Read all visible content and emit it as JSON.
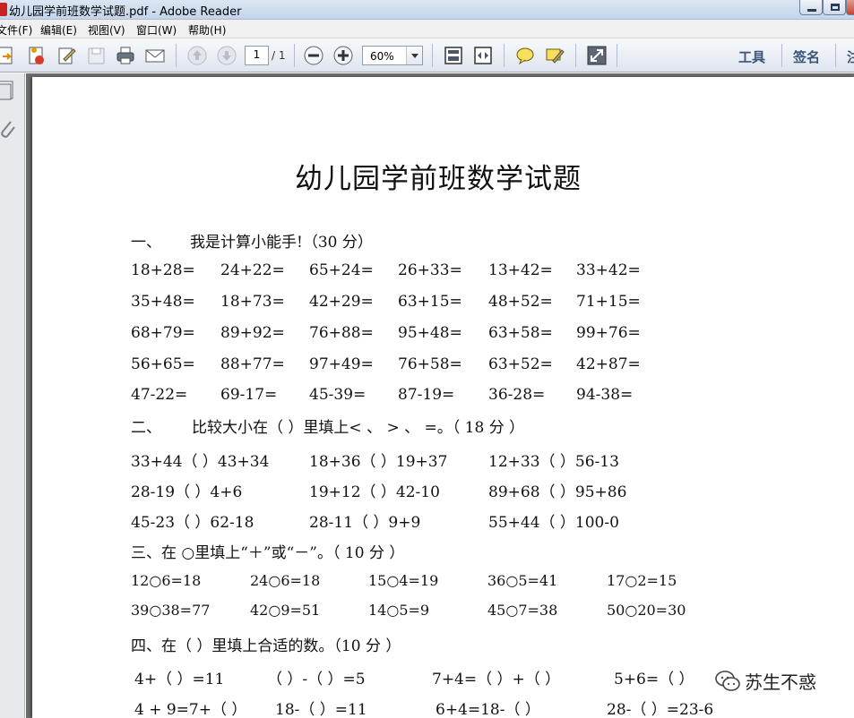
{
  "window": {
    "title": "幼儿园学前班数学试题.pdf - Adobe Reader"
  },
  "menu": {
    "items": [
      "文件(F)",
      "编辑(E)",
      "视图(V)",
      "窗口(W)",
      "帮助(H)"
    ]
  },
  "toolbar": {
    "page_current": "1",
    "page_total": "/ 1",
    "zoom": "60%",
    "tools_label": "工具",
    "sign_label": "签名",
    "comment_label": "注"
  },
  "document": {
    "title": "幼儿园学前班数学试题",
    "section1": {
      "num": "一、",
      "heading": "我是计算小能手!（30 分）",
      "rows": [
        [
          "18+28=",
          "24+22=",
          "65+24=",
          "26+33=",
          "13+42=",
          "33+42="
        ],
        [
          "35+48=",
          "18+73=",
          "42+29=",
          "63+15=",
          "48+52=",
          "71+15="
        ],
        [
          "68+79=",
          "89+92=",
          "76+88=",
          "95+48=",
          "63+58=",
          "99+76="
        ],
        [
          "56+65=",
          "88+77=",
          "97+49=",
          "76+58=",
          "63+52=",
          "42+87="
        ],
        [
          "47-22=",
          "69-17=",
          "45-39=",
          "87-19=",
          "36-28=",
          "94-38="
        ]
      ]
    },
    "section2": {
      "num": "二、",
      "heading": "比较大小在（ ）里填上<  、  >  、  =。（ 18 分 ）",
      "rows": [
        [
          "33+44（    ）43+34",
          "18+36（    ）19+37",
          "12+33（    ）56-13"
        ],
        [
          "28-19（    ）4+6",
          "19+12（    ）42-10",
          "89+68（    ）95+86"
        ],
        [
          "45-23（    ）62-18",
          "28-11（    ）9+9",
          "55+44（    ）100-0"
        ]
      ]
    },
    "section3": {
      "heading": "三、在 ○里填上“＋”或“－”。（ 10 分 ）",
      "rows": [
        [
          "12○6=18",
          "24○6=18",
          "15○4=19",
          "36○5=41",
          "17○2=15"
        ],
        [
          "39○38=77",
          "42○9=51",
          "14○5=9",
          "45○7=38",
          "50○20=30"
        ]
      ]
    },
    "section4": {
      "heading": "四、在（ ）里填上合适的数。（10 分  ）",
      "rows": [
        [
          "4+（  ）=11",
          "（  ）-（    ）=5",
          "7+4=（    ）+（    ）",
          "5+6=（    ）"
        ],
        [
          "4 + 9=7+（    ）",
          "18-（    ）=11",
          "6+4=18-（    ）",
          "28-（  ）=23-6"
        ]
      ]
    }
  },
  "watermark": {
    "text": "苏生不惑"
  }
}
